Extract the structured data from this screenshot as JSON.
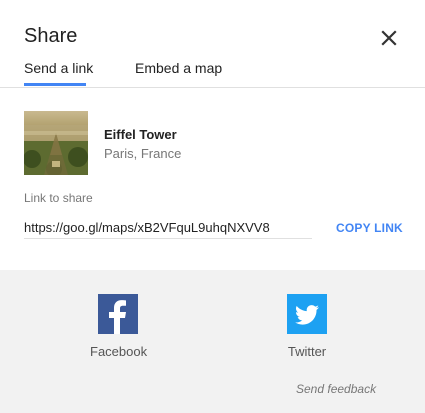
{
  "dialog": {
    "title": "Share",
    "close_icon": "close-icon"
  },
  "tabs": [
    {
      "label": "Send a link",
      "active": true
    },
    {
      "label": "Embed a map",
      "active": false
    }
  ],
  "place": {
    "name": "Eiffel Tower",
    "location": "Paris, France"
  },
  "link": {
    "label": "Link to share",
    "value": "https://goo.gl/maps/xB2VFquL9uhqNXVV8",
    "copy_label": "COPY LINK"
  },
  "social": [
    {
      "label": "Facebook",
      "icon": "facebook-icon",
      "color": "#3b5998"
    },
    {
      "label": "Twitter",
      "icon": "twitter-icon",
      "color": "#1da1f2"
    }
  ],
  "feedback": "Send feedback",
  "colors": {
    "accent": "#4285f4",
    "social_background": "#f2f2f2"
  }
}
